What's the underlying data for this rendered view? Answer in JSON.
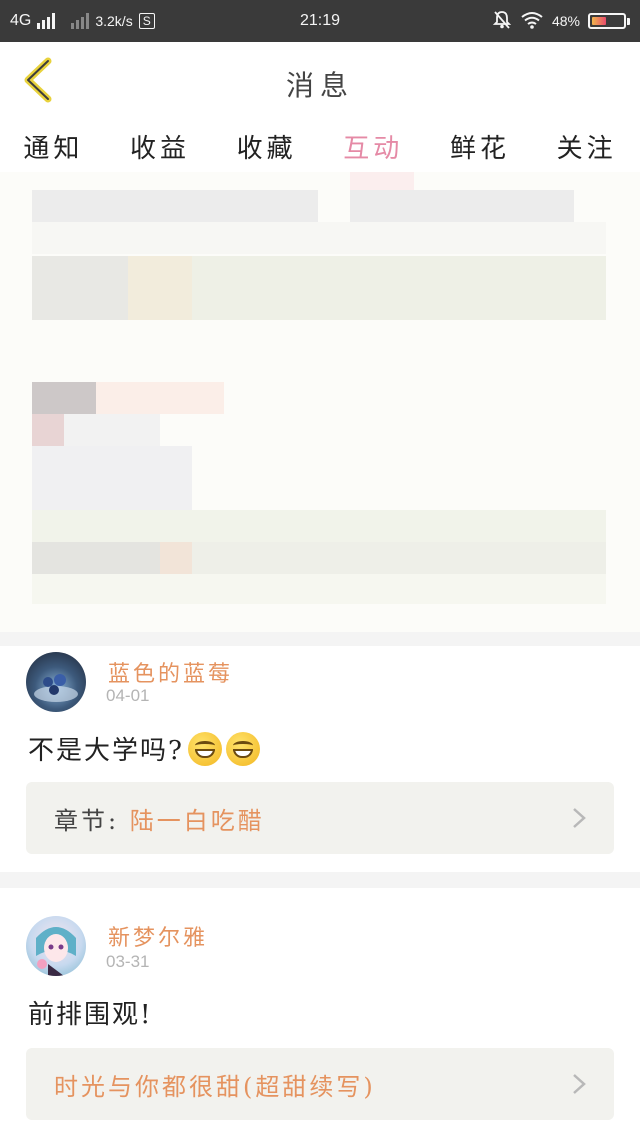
{
  "status_bar": {
    "network": "4G",
    "speed": "3.2k/s",
    "app_badge": "S",
    "time": "21:19",
    "battery": "48%",
    "battery_level": 0.48,
    "icons": [
      "signal-icon",
      "bell-muted-icon",
      "wifi-icon",
      "battery-icon"
    ]
  },
  "nav": {
    "title": "消息",
    "back_icon": "chevron-left-icon",
    "accent": "#e8d23c"
  },
  "tabs": [
    {
      "label": "通知",
      "active": false
    },
    {
      "label": "收益",
      "active": false
    },
    {
      "label": "收藏",
      "active": false
    },
    {
      "label": "互动",
      "active": true
    },
    {
      "label": "鲜花",
      "active": false
    },
    {
      "label": "关注",
      "active": false
    }
  ],
  "items": [
    {
      "username": "蓝色的蓝莓",
      "date": "04-01",
      "comment": "不是大学吗?",
      "emojis": [
        "grin-emoji",
        "grin-emoji"
      ],
      "chapter_label": "章节:",
      "chapter_title": "陆一白吃醋"
    },
    {
      "username": "新梦尔雅",
      "date": "03-31",
      "comment": "前排围观!",
      "chapter_label": "",
      "chapter_title": "时光与你都很甜(超甜续写)"
    }
  ],
  "colors": {
    "accent_orange": "#e5935f",
    "active_tab": "#e58aa6",
    "status_bar": "#3a3a3a"
  }
}
